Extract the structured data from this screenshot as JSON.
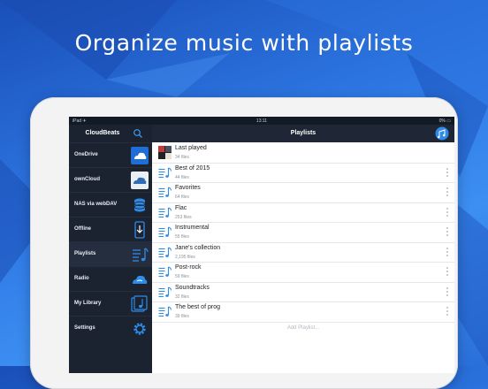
{
  "headline": "Organize music with playlists",
  "status_bar": {
    "left": "iPad ✈",
    "time": "13:11",
    "right": "0% ▭"
  },
  "sidebar": {
    "title": "CloudBeats",
    "items": [
      {
        "label": "OneDrive",
        "icon": "onedrive-icon"
      },
      {
        "label": "ownCloud",
        "icon": "owncloud-icon"
      },
      {
        "label": "NAS via webDAV",
        "icon": "database-icon"
      },
      {
        "label": "Offline",
        "icon": "download-device-icon"
      },
      {
        "label": "Playlists",
        "icon": "playlist-icon",
        "active": true
      },
      {
        "label": "Radio",
        "icon": "radio-cloud-icon"
      },
      {
        "label": "My Library",
        "icon": "library-icon"
      },
      {
        "label": "Settings",
        "icon": "gear-icon"
      }
    ]
  },
  "main": {
    "title": "Playlists",
    "playlists": [
      {
        "title": "Last played",
        "files": "34 files",
        "icon": "album-cover"
      },
      {
        "title": "Best of 2015",
        "files": "44 files",
        "icon": "playlist-icon"
      },
      {
        "title": "Favorites",
        "files": "64 files",
        "icon": "playlist-icon"
      },
      {
        "title": "Flac",
        "files": "253 files",
        "icon": "playlist-icon"
      },
      {
        "title": "Instrumental",
        "files": "55 files",
        "icon": "playlist-icon"
      },
      {
        "title": "Jane's collection",
        "files": "2,195 files",
        "icon": "playlist-icon"
      },
      {
        "title": "Post-rock",
        "files": "59 files",
        "icon": "playlist-icon"
      },
      {
        "title": "Soundtracks",
        "files": "32 files",
        "icon": "playlist-icon"
      },
      {
        "title": "The best of prog",
        "files": "39 files",
        "icon": "playlist-icon"
      }
    ],
    "add_playlist": "Add Playlist..."
  },
  "colors": {
    "accent": "#2f8be8",
    "sidebar_bg": "#1b2230",
    "nav_bg": "#1f2736"
  }
}
